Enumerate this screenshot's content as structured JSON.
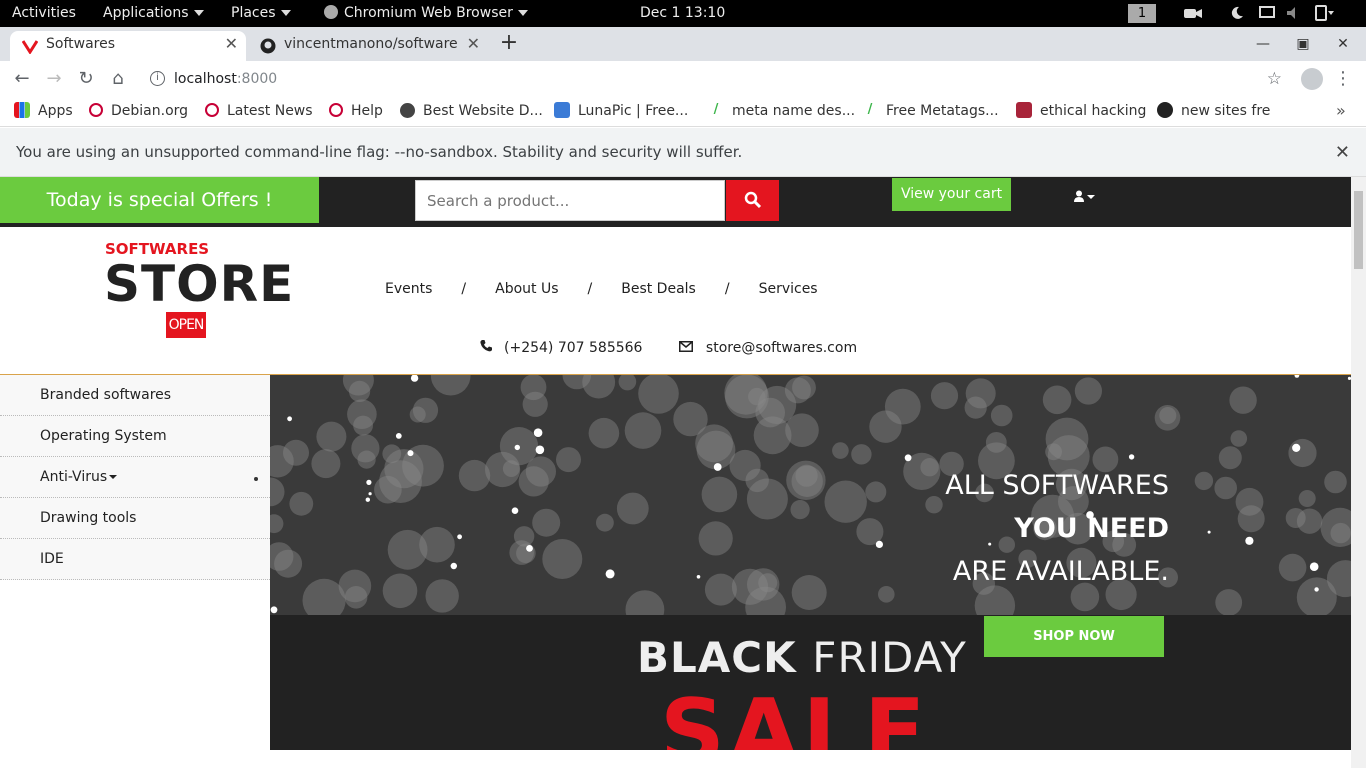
{
  "gnome": {
    "activities": "Activities",
    "applications": "Applications",
    "places": "Places",
    "browser": "Chromium Web Browser",
    "clock": "Dec 1  13:10",
    "workspace": "1"
  },
  "tabs": [
    {
      "title": "Softwares",
      "active": true
    },
    {
      "title": "vincentmanono/software",
      "active": false
    }
  ],
  "address": {
    "host": "localhost",
    "port": ":8000"
  },
  "bookmarks": [
    {
      "label": "Apps",
      "icon": "apps-grid-icon"
    },
    {
      "label": "Debian.org",
      "icon": "debian-icon"
    },
    {
      "label": "Latest News",
      "icon": "debian-icon"
    },
    {
      "label": "Help",
      "icon": "debian-icon"
    },
    {
      "label": "Best Website D...",
      "icon": "globe-icon"
    },
    {
      "label": "LunaPic | Free...",
      "icon": "lunapic-icon"
    },
    {
      "label": "meta name des...",
      "icon": "meta-icon"
    },
    {
      "label": "Free Metatags...",
      "icon": "meta-icon"
    },
    {
      "label": "ethical hacking",
      "icon": "hacking-icon"
    },
    {
      "label": "new sites fre",
      "icon": "sites-icon"
    }
  ],
  "infobar": {
    "message": "You are using an unsupported command-line flag: --no-sandbox. Stability and security will suffer."
  },
  "site": {
    "offer": "Today is special Offers !",
    "search_placeholder": "Search a product...",
    "cart": "View your cart",
    "logo_top": "SOFTWARES",
    "logo_main": "STORE",
    "logo_open": "OPEN",
    "nav": [
      "Events",
      "About Us",
      "Best Deals",
      "Services"
    ],
    "nav_sep": "/",
    "phone": "(+254) 707 585566",
    "email": "store@softwares.com",
    "categories": [
      "Branded softwares",
      "Operating System",
      "Anti-Virus",
      "Drawing tools",
      "IDE"
    ],
    "banner": {
      "line1": "ALL SOFTWARES",
      "line2": "YOU NEED",
      "line3": "ARE AVAILABLE.",
      "cta": "SHOP NOW",
      "bf_black": "BLACK",
      "bf_friday": "FRIDAY",
      "bf_sale": "SALE"
    }
  },
  "colors": {
    "accent_green": "#6bcb3f",
    "accent_red": "#e4151f",
    "dark": "#222222"
  }
}
